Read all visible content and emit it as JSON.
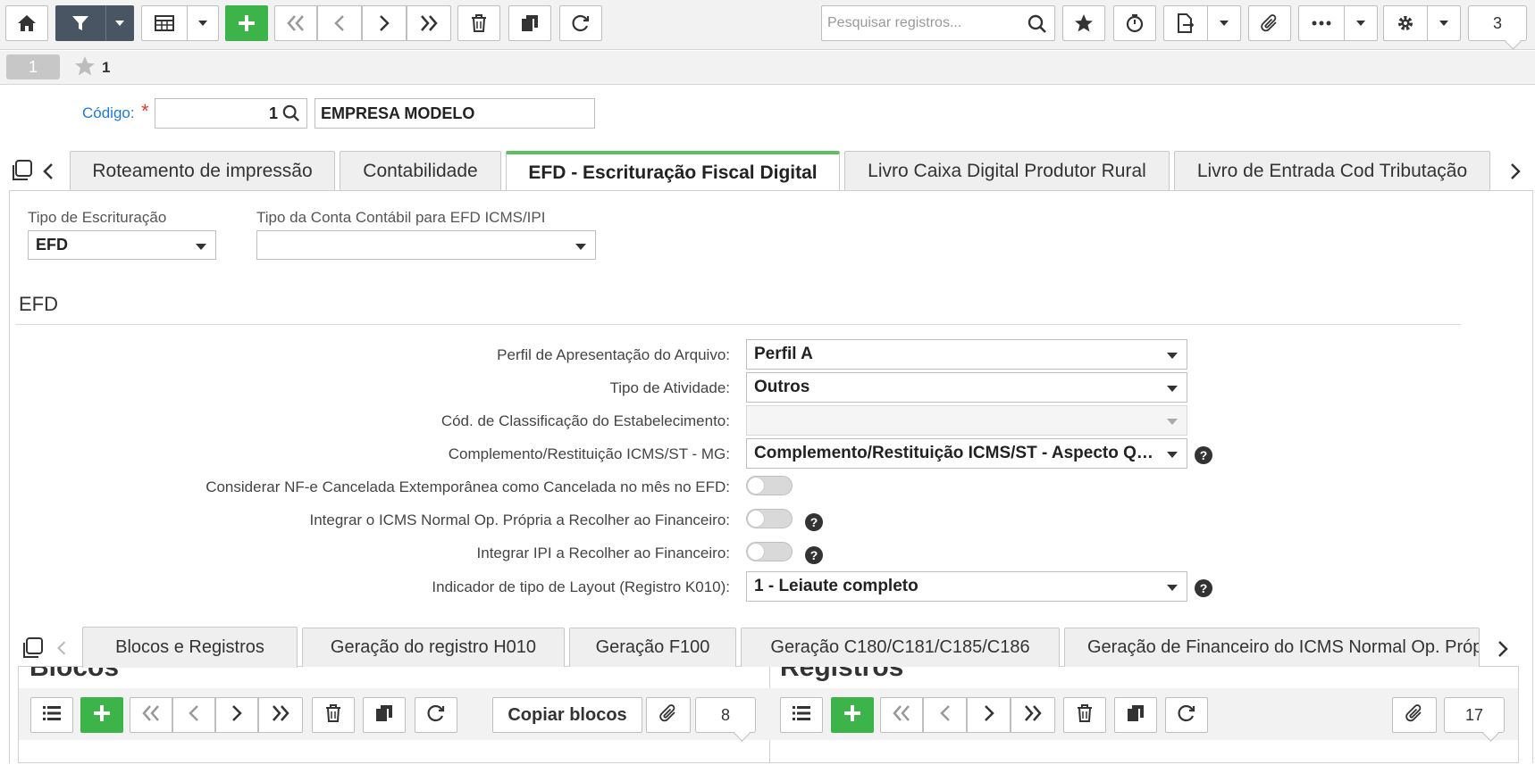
{
  "toolbar": {
    "search_placeholder": "Pesquisar registros...",
    "record_count": "3"
  },
  "record_tabs": {
    "current": "1",
    "favorites_count": "1"
  },
  "header": {
    "codigo_label": "Código:",
    "required_mark": "*",
    "codigo_value": "1",
    "empresa_value": "EMPRESA MODELO"
  },
  "main_tabs": [
    {
      "label": "Roteamento de impressão"
    },
    {
      "label": "Contabilidade"
    },
    {
      "label": "EFD - Escrituração Fiscal Digital"
    },
    {
      "label": "Livro Caixa Digital Produtor Rural"
    },
    {
      "label": "Livro de Entrada Cod Tributação"
    }
  ],
  "top_fields": {
    "tipo_escrituracao_label": "Tipo de Escrituração",
    "tipo_escrituracao_value": "EFD",
    "tipo_conta_label": "Tipo da Conta Contábil para EFD ICMS/IPI",
    "tipo_conta_value": ""
  },
  "efd": {
    "section_title": "EFD",
    "perfil_label": "Perfil de Apresentação do Arquivo:",
    "perfil_value": "Perfil A",
    "atividade_label": "Tipo de Atividade:",
    "atividade_value": "Outros",
    "classificacao_label": "Cód. de Classificação do Estabelecimento:",
    "classificacao_value": "",
    "complemento_label": "Complemento/Restituição ICMS/ST - MG:",
    "complemento_value": "Complemento/Restituição ICMS/ST - Aspecto Quantitativo",
    "nfe_cancelada_label": "Considerar NF-e Cancelada Extemporânea como Cancelada no mês no EFD:",
    "icms_normal_label": "Integrar o ICMS Normal Op. Própria a Recolher ao Financeiro:",
    "ipi_label": "Integrar IPI a Recolher ao Financeiro:",
    "layout_label": "Indicador de tipo de Layout (Registro K010):",
    "layout_value": "1 - Leiaute completo",
    "help_symbol": "?"
  },
  "sub_tabs": [
    {
      "label": "Blocos e Registros"
    },
    {
      "label": "Geração do registro H010"
    },
    {
      "label": "Geração F100"
    },
    {
      "label": "Geração C180/C181/C185/C186"
    },
    {
      "label": "Geração de Financeiro do ICMS Normal Op. Própria"
    }
  ],
  "blocos": {
    "title": "Blocos",
    "copy_button": "Copiar blocos",
    "count": "8"
  },
  "registros": {
    "title": "Registros",
    "count": "17"
  }
}
